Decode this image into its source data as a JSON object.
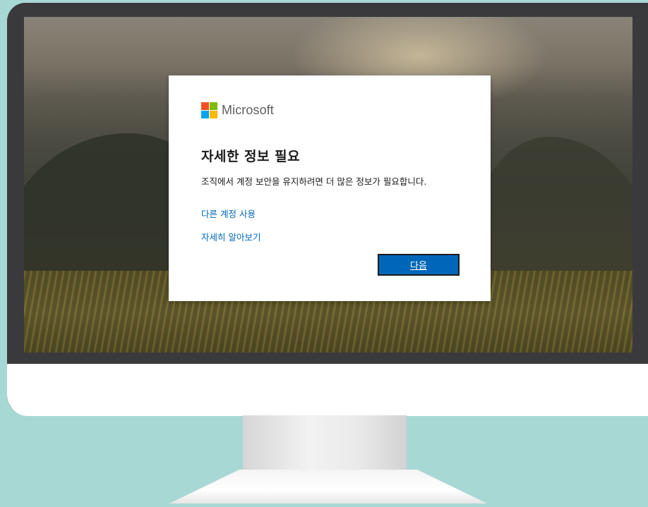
{
  "dialog": {
    "brand_name": "Microsoft",
    "title": "자세한 정보 필요",
    "description": "조직에서 계정 보안을 유지하려면 더 많은 정보가 필요합니다.",
    "use_other_account_link": "다른 계정 사용",
    "learn_more_link": "자세히 알아보기",
    "next_button": "다음"
  },
  "colors": {
    "background": "#a8d8d4",
    "monitor_bezel": "#3a3a3d",
    "link_blue": "#0067b8",
    "button_blue": "#0067b8",
    "logo_red": "#f25022",
    "logo_green": "#7fba00",
    "logo_blue": "#00a4ef",
    "logo_yellow": "#ffb900"
  },
  "icons": {
    "brand_logo": "microsoft-logo-icon"
  }
}
